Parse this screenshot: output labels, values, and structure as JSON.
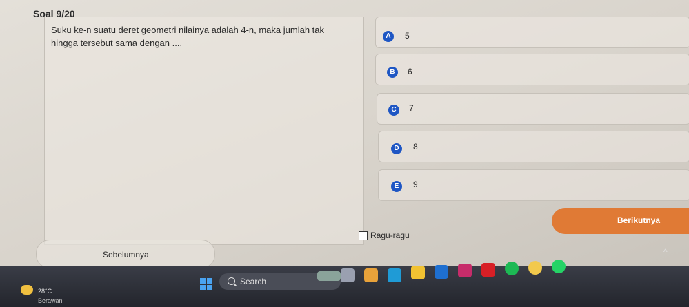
{
  "quiz": {
    "title": "Soal 9/20",
    "question": "Suku ke-n suatu deret geometri nilainya adalah 4-n, maka jumlah tak hingga tersebut sama dengan ....",
    "options": [
      {
        "letter": "A",
        "value": "5"
      },
      {
        "letter": "B",
        "value": "6"
      },
      {
        "letter": "C",
        "value": "7"
      },
      {
        "letter": "D",
        "value": "8"
      },
      {
        "letter": "E",
        "value": "9"
      }
    ],
    "next_label": "Berikutnya",
    "prev_label": "Sebelumnya",
    "doubt_label": "Ragu-ragu"
  },
  "taskbar": {
    "temperature": "28°C",
    "weather": "Berawan",
    "search_label": "Search",
    "apps": [
      {
        "icon": "landscape-widget-icon",
        "color": "#8aa39a"
      },
      {
        "icon": "task-view-icon",
        "color": "#9aa0b0"
      },
      {
        "icon": "copilot-icon",
        "color": "#e8a23a"
      },
      {
        "icon": "edge-icon",
        "color": "#1f9bd6"
      },
      {
        "icon": "file-explorer-icon",
        "color": "#f1c232"
      },
      {
        "icon": "outlook-icon",
        "color": "#1e6fd0"
      },
      {
        "icon": "media-player-icon",
        "color": "#c72c6a"
      },
      {
        "icon": "netflix-icon",
        "color": "#d81f26"
      },
      {
        "icon": "spotify-icon",
        "color": "#1db954"
      },
      {
        "icon": "chrome-canary-icon",
        "color": "#f2c94c"
      },
      {
        "icon": "whatsapp-icon",
        "color": "#25d366"
      }
    ]
  }
}
